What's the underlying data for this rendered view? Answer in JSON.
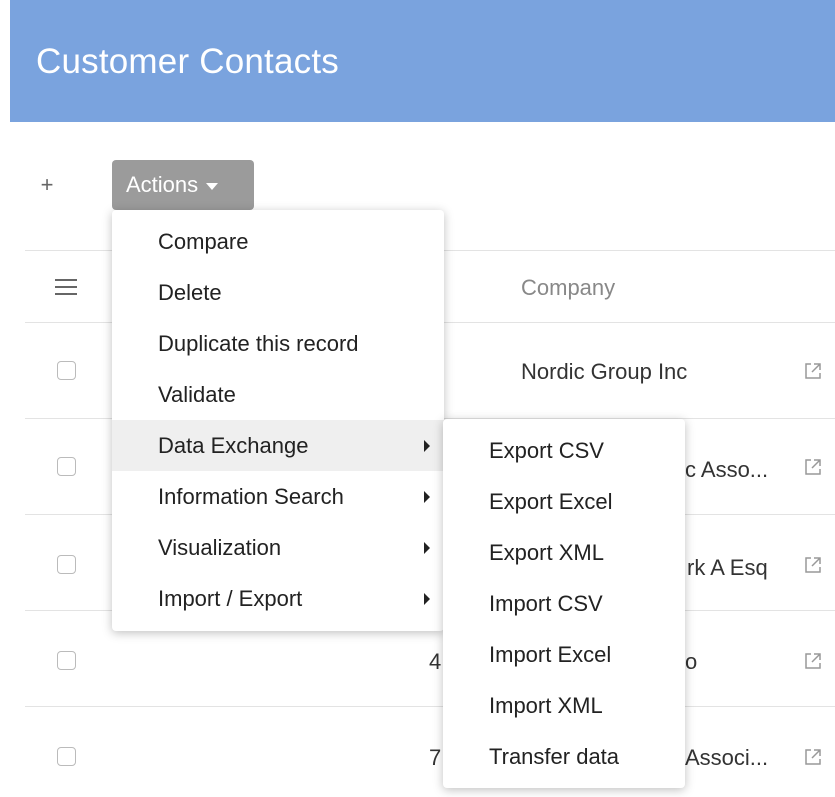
{
  "header": {
    "title": "Customer Contacts",
    "color": "#7aa3de"
  },
  "toolbar": {
    "add_label": "+",
    "actions_label": "Actions"
  },
  "table": {
    "columns": [
      "Company"
    ],
    "rows": [
      {
        "company": "Nordic Group Inc",
        "number": ""
      },
      {
        "company": "c Asso...",
        "number": ""
      },
      {
        "company": "rk A Esq",
        "number": ""
      },
      {
        "company": "o",
        "number": "4"
      },
      {
        "company": "Associ...",
        "number": "7"
      }
    ]
  },
  "menu": {
    "items": [
      {
        "label": "Compare",
        "submenu": false
      },
      {
        "label": "Delete",
        "submenu": false
      },
      {
        "label": "Duplicate this record",
        "submenu": false
      },
      {
        "label": "Validate",
        "submenu": false
      },
      {
        "label": "Data Exchange",
        "submenu": true,
        "active": true
      },
      {
        "label": "Information Search",
        "submenu": true
      },
      {
        "label": "Visualization",
        "submenu": true
      },
      {
        "label": "Import / Export",
        "submenu": true
      }
    ]
  },
  "submenu": {
    "items": [
      "Export CSV",
      "Export Excel",
      "Export XML",
      "Import CSV",
      "Import Excel",
      "Import XML",
      "Transfer data"
    ]
  },
  "icons": {
    "add": "plus-icon",
    "actions_caret": "caret-down-icon",
    "column_menu": "hamburger-icon",
    "row_link": "external-link-icon",
    "submenu_arrow": "chevron-right-icon"
  }
}
